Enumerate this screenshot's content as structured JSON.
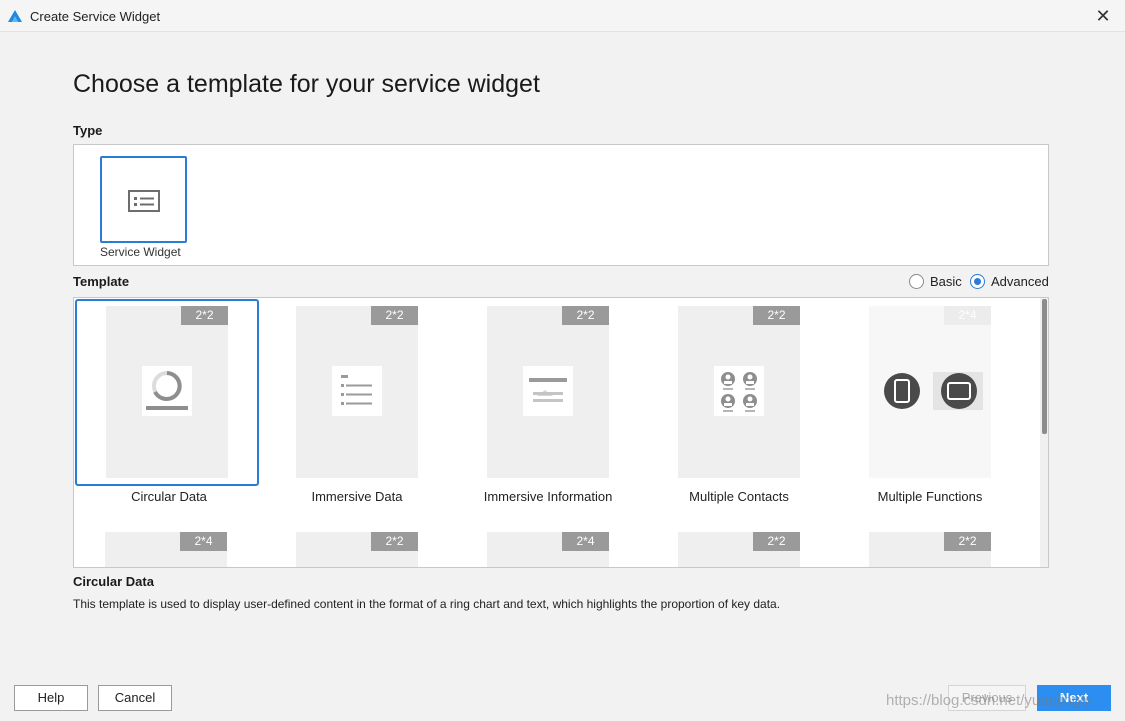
{
  "window": {
    "title": "Create Service Widget",
    "close_glyph": "✕",
    "icon": "harmony-logo-icon"
  },
  "heading": "Choose a template for your service widget",
  "type_section": {
    "label": "Type",
    "cards": [
      {
        "label": "Service Widget",
        "icon": "widget-list-icon",
        "selected": true
      }
    ]
  },
  "template_section": {
    "label": "Template",
    "modes": [
      {
        "label": "Basic",
        "selected": false
      },
      {
        "label": "Advanced",
        "selected": true
      }
    ],
    "cards": [
      {
        "label": "Circular Data",
        "size": "2*2",
        "selected": true,
        "icon": "ring-chart-icon"
      },
      {
        "label": "Immersive Data",
        "size": "2*2",
        "selected": false,
        "icon": "list-lines-icon"
      },
      {
        "label": "Immersive Information",
        "size": "2*2",
        "selected": false,
        "icon": "image-text-icon"
      },
      {
        "label": "Multiple Contacts",
        "size": "2*2",
        "selected": false,
        "icon": "contacts-grid-icon"
      },
      {
        "label": "Multiple Functions",
        "size": "2*4",
        "selected": false,
        "icon": "devices-icon"
      },
      {
        "label": "",
        "size": "2*4",
        "selected": false
      },
      {
        "label": "",
        "size": "2*2",
        "selected": false
      },
      {
        "label": "",
        "size": "2*4",
        "selected": false
      },
      {
        "label": "",
        "size": "2*2",
        "selected": false
      },
      {
        "label": "",
        "size": "2*2",
        "selected": false
      }
    ]
  },
  "description": {
    "title": "Circular Data",
    "text": "This template is used to display user-defined content in the format of a ring chart and text, which highlights the proportion of key data."
  },
  "buttons": {
    "help": "Help",
    "cancel": "Cancel",
    "previous": "Previous",
    "next": "Next"
  },
  "watermark": "https://blog.csdn.net/yuanjingly",
  "colors": {
    "accent": "#2b7bd8",
    "primary_button": "#2b8ef0",
    "badge": "#9a9a9a"
  }
}
